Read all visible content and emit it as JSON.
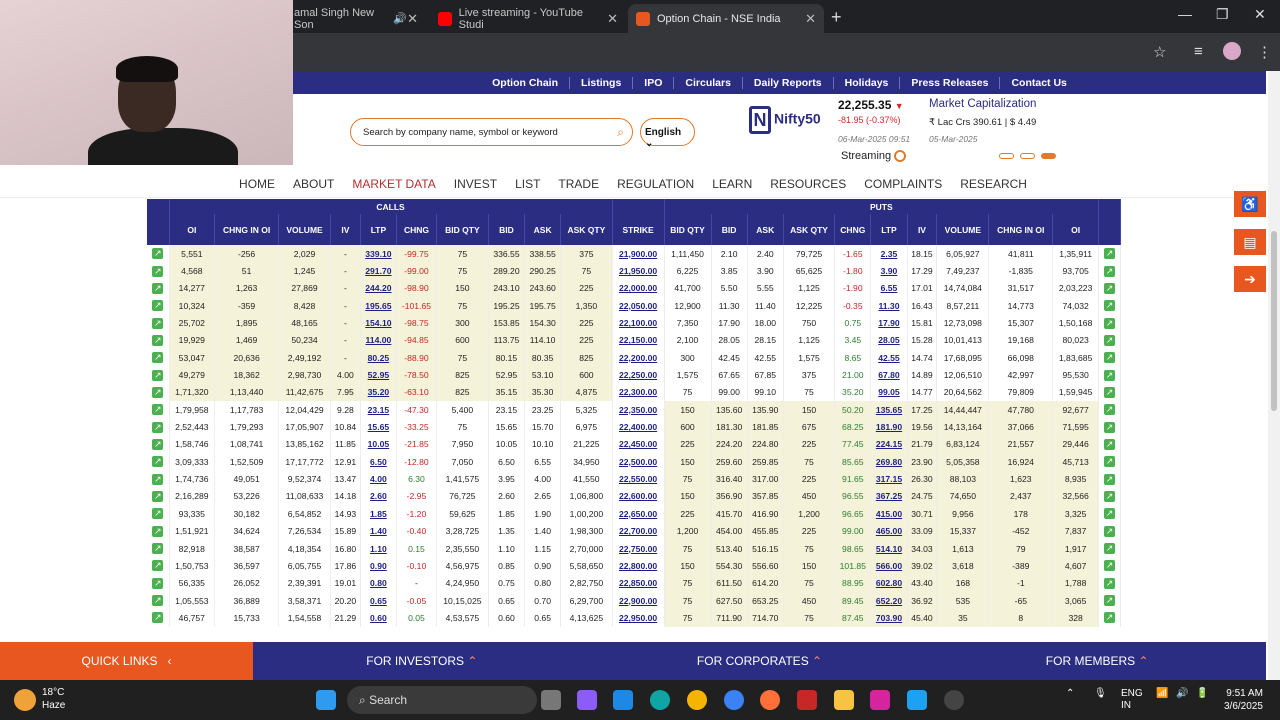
{
  "browser": {
    "tabs": [
      {
        "label": "amal Singh New Son",
        "active": false
      },
      {
        "label": "Live streaming - YouTube Studi",
        "active": false
      },
      {
        "label": "Option Chain - NSE India",
        "active": true
      }
    ]
  },
  "top_nav": [
    "Option Chain",
    "Listings",
    "IPO",
    "Circulars",
    "Daily Reports",
    "Holidays",
    "Press Releases",
    "Contact Us"
  ],
  "search": {
    "placeholder": "Search by company name, symbol or keyword"
  },
  "language": "English",
  "index": {
    "name": "Nifty50",
    "value": "22,255.35",
    "change": "-81.95 (-0.37%)",
    "date": "06-Mar-2025 09:51",
    "status": "Streaming"
  },
  "market_cap": {
    "title": "Market Capitalization",
    "value": "₹ Lac Crs 390.61 | $ 4.49",
    "date": "05-Mar-2025"
  },
  "main_nav": [
    "HOME",
    "ABOUT",
    "MARKET DATA",
    "INVEST",
    "LIST",
    "TRADE",
    "REGULATION",
    "LEARN",
    "RESOURCES",
    "COMPLAINTS",
    "RESEARCH"
  ],
  "main_nav_selected": "MARKET DATA",
  "table": {
    "group_calls": "CALLS",
    "group_puts": "PUTS",
    "columns": [
      "OI",
      "CHNG IN OI",
      "VOLUME",
      "IV",
      "LTP",
      "CHNG",
      "BID QTY",
      "BID",
      "ASK",
      "ASK QTY",
      "STRIKE",
      "BID QTY",
      "BID",
      "ASK",
      "ASK QTY",
      "CHNG",
      "LTP",
      "IV",
      "VOLUME",
      "CHNG IN OI",
      "OI"
    ],
    "rows": [
      [
        "5,551",
        "-256",
        "2,029",
        "-",
        "339.10",
        "-99.75",
        "75",
        "336.55",
        "338.55",
        "375",
        "21,900.00",
        "1,11,450",
        "2.10",
        "2.40",
        "79,725",
        "-1.65",
        "2.35",
        "18.15",
        "6,05,927",
        "41,811",
        "1,35,911"
      ],
      [
        "4,568",
        "51",
        "1,245",
        "-",
        "291.70",
        "-99.00",
        "75",
        "289.20",
        "290.25",
        "75",
        "21,950.00",
        "6,225",
        "3.85",
        "3.90",
        "65,625",
        "-1.80",
        "3.90",
        "17.29",
        "7,49,237",
        "-1,835",
        "93,705"
      ],
      [
        "14,277",
        "1,263",
        "27,869",
        "-",
        "244.20",
        "-98.90",
        "150",
        "243.10",
        "243.60",
        "225",
        "22,000.00",
        "41,700",
        "5.50",
        "5.55",
        "1,125",
        "-1.90",
        "6.55",
        "17.01",
        "14,74,084",
        "31,517",
        "2,03,223"
      ],
      [
        "10,324",
        "-359",
        "8,428",
        "-",
        "195.65",
        "-101.65",
        "75",
        "195.25",
        "195.75",
        "1,350",
        "22,050.00",
        "12,900",
        "11.30",
        "11.40",
        "12,225",
        "-0.35",
        "11.30",
        "16.43",
        "8,57,211",
        "14,773",
        "74,032"
      ],
      [
        "25,702",
        "1,895",
        "48,165",
        "-",
        "154.10",
        "-98.75",
        "300",
        "153.85",
        "154.30",
        "225",
        "22,100.00",
        "7,350",
        "17.90",
        "18.00",
        "750",
        "0.75",
        "17.90",
        "15.81",
        "12,73,098",
        "15,307",
        "1,50,168"
      ],
      [
        "19,929",
        "1,469",
        "50,234",
        "-",
        "114.00",
        "-94.85",
        "600",
        "113.75",
        "114.10",
        "225",
        "22,150.00",
        "2,100",
        "28.05",
        "28.15",
        "1,125",
        "3.45",
        "28.05",
        "15.28",
        "10,01,413",
        "19,168",
        "80,023"
      ],
      [
        "53,047",
        "20,636",
        "2,49,192",
        "-",
        "80.25",
        "-88.90",
        "75",
        "80.15",
        "80.35",
        "825",
        "22,200.00",
        "300",
        "42.45",
        "42.55",
        "1,575",
        "8.65",
        "42.55",
        "14.74",
        "17,68,095",
        "66,098",
        "1,83,685"
      ],
      [
        "49,279",
        "18,362",
        "2,98,730",
        "4.00",
        "52.95",
        "-78.50",
        "825",
        "52.95",
        "53.10",
        "600",
        "22,250.00",
        "1,575",
        "67.65",
        "67.85",
        "375",
        "21.00",
        "67.80",
        "14.89",
        "12,06,510",
        "42,997",
        "95,530"
      ],
      [
        "1,71,320",
        "1,13,440",
        "11,42,675",
        "7.95",
        "35.20",
        "-63.10",
        "825",
        "35.15",
        "35.30",
        "4,875",
        "22,300.00",
        "75",
        "99.00",
        "99.10",
        "75",
        "35.20",
        "99.05",
        "14.77",
        "20,64,562",
        "79,809",
        "1,59,945"
      ],
      [
        "1,79,958",
        "1,17,783",
        "12,04,429",
        "9.28",
        "23.15",
        "-47.30",
        "5,400",
        "23.15",
        "23.25",
        "5,325",
        "22,350.00",
        "150",
        "135.60",
        "135.90",
        "150",
        "50.20",
        "135.65",
        "17.25",
        "14,44,447",
        "47,780",
        "92,677"
      ],
      [
        "2,52,443",
        "1,79,293",
        "17,05,907",
        "10.84",
        "15.65",
        "-33.25",
        "75",
        "15.65",
        "15.70",
        "6,975",
        "22,400.00",
        "600",
        "181.30",
        "181.85",
        "675",
        "68.25",
        "181.90",
        "19.56",
        "14,13,164",
        "37,066",
        "71,595"
      ],
      [
        "1,58,746",
        "1,08,741",
        "13,85,162",
        "11.85",
        "10.05",
        "-21.85",
        "7,950",
        "10.05",
        "10.10",
        "21,225",
        "22,450.00",
        "225",
        "224.20",
        "224.80",
        "225",
        "77.45",
        "224.15",
        "21.79",
        "6,83,124",
        "21,557",
        "29,446"
      ],
      [
        "3,09,333",
        "1,52,509",
        "17,17,772",
        "12.91",
        "6.50",
        "-12.80",
        "7,050",
        "6.50",
        "6.55",
        "34,950",
        "22,500.00",
        "150",
        "259.60",
        "259.85",
        "75",
        "85.65",
        "269.80",
        "23.90",
        "5,05,358",
        "16,924",
        "45,713"
      ],
      [
        "1,74,736",
        "49,051",
        "9,52,374",
        "13.47",
        "4.00",
        "6.30",
        "1,41,575",
        "3.95",
        "4.00",
        "41,550",
        "22,550.00",
        "75",
        "316.40",
        "317.00",
        "225",
        "91.65",
        "317.15",
        "26.30",
        "88,103",
        "1,623",
        "8,935"
      ],
      [
        "2,16,289",
        "53,226",
        "11,08,633",
        "14.18",
        "2.60",
        "-2.95",
        "76,725",
        "2.60",
        "2.65",
        "1,06,800",
        "22,600.00",
        "150",
        "356.90",
        "357.85",
        "450",
        "96.55",
        "367.25",
        "24.75",
        "74,650",
        "2,437",
        "32,566"
      ],
      [
        "93,335",
        "30,182",
        "6,54,852",
        "14.93",
        "1.85",
        "-1.20",
        "59,625",
        "1.85",
        "1.90",
        "1,00,200",
        "22,650.00",
        "225",
        "415.70",
        "416.90",
        "1,200",
        "96.65",
        "415.00",
        "30.71",
        "9,956",
        "178",
        "3,325"
      ],
      [
        "1,51,921",
        "34,624",
        "7,26,534",
        "15.89",
        "1.40",
        "-0.40",
        "3,28,725",
        "1.35",
        "1.40",
        "1,98,300",
        "22,700.00",
        "1,200",
        "454.00",
        "455.85",
        "225",
        "99.00",
        "465.00",
        "33.09",
        "15,337",
        "-452",
        "7,837"
      ],
      [
        "82,918",
        "38,587",
        "4,18,354",
        "16.80",
        "1.10",
        "0.15",
        "2,35,550",
        "1.10",
        "1.15",
        "2,70,000",
        "22,750.00",
        "75",
        "513.40",
        "516.15",
        "75",
        "98.65",
        "514.10",
        "34.03",
        "1,613",
        "79",
        "1,917"
      ],
      [
        "1,50,753",
        "36,597",
        "6,05,755",
        "17.86",
        "0.90",
        "-0.10",
        "4,56,975",
        "0.85",
        "0.90",
        "5,58,650",
        "22,800.00",
        "150",
        "554.30",
        "556.60",
        "150",
        "101.85",
        "566.00",
        "39.02",
        "3,618",
        "-389",
        "4,607"
      ],
      [
        "56,335",
        "26,052",
        "2,39,391",
        "19.01",
        "0.80",
        "-",
        "4,24,950",
        "0.75",
        "0.80",
        "2,82,750",
        "22,850.00",
        "75",
        "611.50",
        "614.20",
        "75",
        "88.95",
        "602.80",
        "43.40",
        "168",
        "-1",
        "1,788"
      ],
      [
        "1,05,553",
        "36,889",
        "3,58,371",
        "20.20",
        "0.65",
        "-0.05",
        "10,15,025",
        "0.65",
        "0.70",
        "6,29,700",
        "22,900.00",
        "75",
        "627.50",
        "653.25",
        "450",
        "89.45",
        "652.20",
        "36.92",
        "535",
        "-65",
        "3,065"
      ],
      [
        "46,757",
        "15,733",
        "1,54,558",
        "21.29",
        "0.60",
        "0.05",
        "4,53,575",
        "0.60",
        "0.65",
        "4,13,625",
        "22,950.00",
        "75",
        "711.90",
        "714.70",
        "75",
        "87.45",
        "703.90",
        "45.40",
        "35",
        "8",
        "328"
      ]
    ],
    "itm_call_rows": 9
  },
  "footer": {
    "quick_links": "QUICK LINKS",
    "links": [
      "FOR INVESTORS",
      "FOR CORPORATES",
      "FOR MEMBERS"
    ]
  },
  "taskbar": {
    "temp": "18°C",
    "weather": "Haze",
    "search": "Search",
    "lang1": "ENG",
    "lang2": "IN",
    "time": "9:51 AM",
    "date": "3/6/2025"
  }
}
